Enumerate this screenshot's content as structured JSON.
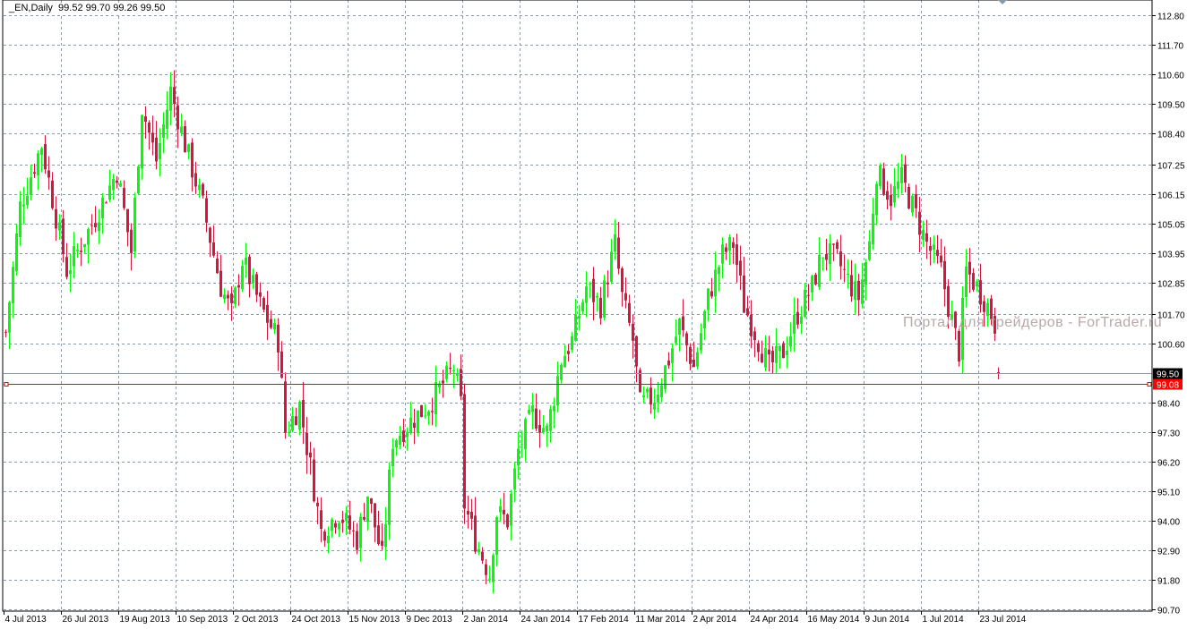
{
  "header": {
    "symbol": "_EN,Daily",
    "ohlc": "99.52 99.70 99.26 99.50"
  },
  "watermark": "Портал для трейдеров - ForTrader.ru",
  "colors": {
    "bull": "#00ff00",
    "bear": "#dc143c",
    "grid": "#8c9aa8",
    "bid_line": "#8899aa",
    "alert_line": "#ff0000"
  },
  "chart_data": {
    "type": "candlestick",
    "title": "_EN,Daily",
    "bars_count": 278,
    "close_path": [
      [
        0,
        101.0
      ],
      [
        4,
        105.7
      ],
      [
        10,
        108.0
      ],
      [
        17,
        103.3
      ],
      [
        24,
        105.0
      ],
      [
        31,
        107.0
      ],
      [
        35,
        104.0
      ],
      [
        38,
        109.4
      ],
      [
        42,
        107.4
      ],
      [
        46,
        110.0
      ],
      [
        50,
        108.0
      ],
      [
        55,
        105.7
      ],
      [
        60,
        102.7
      ],
      [
        63,
        101.7
      ],
      [
        66,
        103.7
      ],
      [
        71,
        102.0
      ],
      [
        76,
        100.7
      ],
      [
        78,
        97.3
      ],
      [
        82,
        98.3
      ],
      [
        85,
        96.0
      ],
      [
        88,
        93.6
      ],
      [
        93,
        94.3
      ],
      [
        98,
        93.3
      ],
      [
        101,
        95.0
      ],
      [
        105,
        92.6
      ],
      [
        108,
        97.0
      ],
      [
        113,
        97.7
      ],
      [
        118,
        98.3
      ],
      [
        125,
        99.7
      ],
      [
        127,
        98.3
      ],
      [
        128,
        94.6
      ],
      [
        131,
        93.3
      ],
      [
        135,
        92.0
      ],
      [
        137,
        94.3
      ],
      [
        140,
        94.0
      ],
      [
        143,
        96.6
      ],
      [
        147,
        98.0
      ],
      [
        151,
        97.3
      ],
      [
        155,
        100.0
      ],
      [
        158,
        100.7
      ],
      [
        162,
        102.7
      ],
      [
        166,
        102.0
      ],
      [
        170,
        104.3
      ],
      [
        172,
        102.3
      ],
      [
        175,
        100.7
      ],
      [
        177,
        98.3
      ],
      [
        181,
        98.6
      ],
      [
        185,
        100.0
      ],
      [
        188,
        101.3
      ],
      [
        192,
        99.7
      ],
      [
        196,
        102.3
      ],
      [
        200,
        103.9
      ],
      [
        203,
        104.3
      ],
      [
        206,
        102.0
      ],
      [
        210,
        100.7
      ],
      [
        213,
        99.7
      ],
      [
        217,
        100.3
      ],
      [
        221,
        101.7
      ],
      [
        225,
        102.7
      ],
      [
        228,
        104.0
      ],
      [
        232,
        103.7
      ],
      [
        236,
        102.7
      ],
      [
        238,
        102.3
      ],
      [
        241,
        104.3
      ],
      [
        243,
        107.0
      ],
      [
        247,
        106.0
      ],
      [
        250,
        106.7
      ],
      [
        253,
        105.7
      ],
      [
        257,
        104.3
      ],
      [
        261,
        103.3
      ],
      [
        263,
        102.0
      ],
      [
        266,
        100.3
      ],
      [
        268,
        103.3
      ],
      [
        271,
        102.7
      ],
      [
        274,
        102.0
      ],
      [
        276,
        101.3
      ],
      [
        277,
        99.5
      ]
    ],
    "last_bar": {
      "open": 99.52,
      "high": 99.7,
      "low": 99.26,
      "close": 99.5
    },
    "ylim": [
      90.7,
      112.8
    ],
    "y_ticks": [
      "112.80",
      "111.70",
      "110.60",
      "109.50",
      "108.40",
      "107.25",
      "106.15",
      "105.05",
      "103.95",
      "102.85",
      "101.70",
      "100.60",
      "98.40",
      "97.30",
      "96.20",
      "95.10",
      "94.00",
      "92.90",
      "91.80",
      "90.70"
    ],
    "x_ticks": [
      "4 Jul 2013",
      "26 Jul 2013",
      "19 Aug 2013",
      "10 Sep 2013",
      "2 Oct 2013",
      "24 Oct 2013",
      "15 Nov 2013",
      "9 Dec 2013",
      "2 Jan 2014",
      "24 Jan 2014",
      "17 Feb 2014",
      "11 Mar 2014",
      "2 Apr 2014",
      "24 Apr 2014",
      "16 May 2014",
      "9 Jun 2014",
      "1 Jul 2014",
      "23 Jul 2014"
    ],
    "bid_price": "99.50",
    "alert_price": "99.08",
    "grid": true
  }
}
